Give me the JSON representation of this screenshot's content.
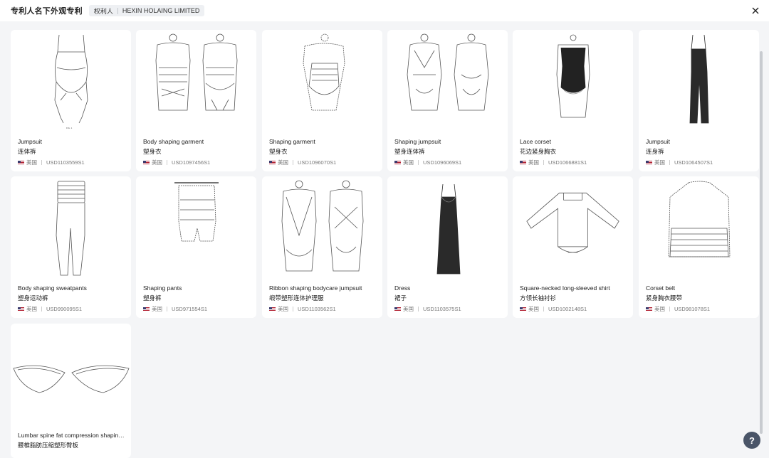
{
  "header": {
    "title": "专利人名下外观专利",
    "owner_label": "权利人",
    "owner_name": "HEXIN HOLAING LIMITED"
  },
  "help_label": "?",
  "cards": [
    {
      "en": "Jumpsuit",
      "zh": "连体裤",
      "country": "美国",
      "number": "USD1103559S1",
      "icon": "jumpsuit-drawing"
    },
    {
      "en": "Body shaping garment",
      "zh": "塑身衣",
      "country": "美国",
      "number": "USD1097456S1",
      "icon": "body-shaping-garment-drawing"
    },
    {
      "en": "Shaping garment",
      "zh": "塑身衣",
      "country": "美国",
      "number": "USD1096070S1",
      "icon": "shaping-garment-drawing"
    },
    {
      "en": "Shaping jumpsuit",
      "zh": "塑身连体裤",
      "country": "美国",
      "number": "USD1096069S1",
      "icon": "shaping-jumpsuit-drawing"
    },
    {
      "en": "Lace corset",
      "zh": "花边紧身胸衣",
      "country": "美国",
      "number": "USD1066881S1",
      "icon": "lace-corset-photo"
    },
    {
      "en": "Jumpsuit",
      "zh": "连身裤",
      "country": "美国",
      "number": "USD1064507S1",
      "icon": "jumpsuit-photo"
    },
    {
      "en": "Body shaping sweatpants",
      "zh": "塑身运动裤",
      "country": "美国",
      "number": "USD990095S1",
      "icon": "sweatpants-drawing"
    },
    {
      "en": "Shaping pants",
      "zh": "塑身裤",
      "country": "美国",
      "number": "USD971554S1",
      "icon": "shaping-pants-drawing"
    },
    {
      "en": "Ribbon shaping bodycare jumpsuit",
      "zh": "缎带塑形连体护理服",
      "country": "美国",
      "number": "USD1103562S1",
      "icon": "ribbon-jumpsuit-drawing"
    },
    {
      "en": "Dress",
      "zh": "裙子",
      "country": "美国",
      "number": "USD1103575S1",
      "icon": "dress-photo"
    },
    {
      "en": "Square-necked long-sleeved shirt",
      "zh": "方领长袖衬衫",
      "country": "美国",
      "number": "USD1002148S1",
      "icon": "long-sleeve-shirt-drawing"
    },
    {
      "en": "Corset belt",
      "zh": "紧身胸衣腰带",
      "country": "美国",
      "number": "USD981078S1",
      "icon": "corset-belt-drawing"
    },
    {
      "en": "Lumbar spine fat compression shaping board",
      "zh": "腰椎脂肪压缩塑形臀板",
      "country": "",
      "number": "",
      "icon": "compression-board-drawing"
    }
  ]
}
